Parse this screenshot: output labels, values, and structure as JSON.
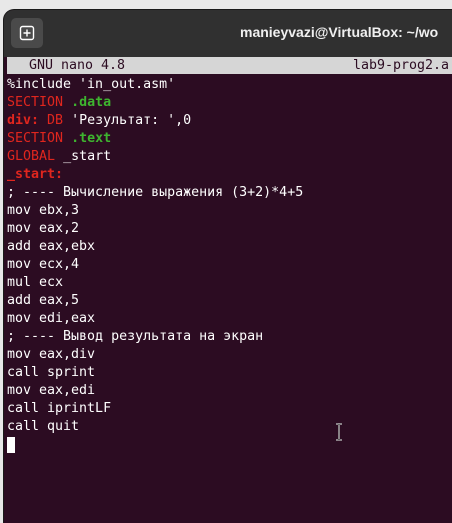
{
  "window": {
    "title": "manieyvazi@VirtualBox: ~/wo",
    "newtab_icon": "plus-in-square-icon"
  },
  "nano": {
    "version": "GNU nano 4.8",
    "filename": "lab9-prog2.a"
  },
  "lines": {
    "l1": "%include 'in_out.asm'",
    "l2a": "SECTION",
    "l2b": ".data",
    "l3a": "div:",
    "l3b": "DB",
    "l3c": "'Результат: ',0",
    "l4a": "SECTION",
    "l4b": ".text",
    "l5a": "GLOBAL",
    "l5b": "_start",
    "l6": "_start:",
    "l7": "; ---- Вычисление выражения (3+2)*4+5",
    "l8": "mov ebx,3",
    "l9": "mov eax,2",
    "l10": "add eax,ebx",
    "l11": "mov ecx,4",
    "l12": "mul ecx",
    "l13": "add eax,5",
    "l14": "mov edi,eax",
    "l15": "; ---- Вывод результата на экран",
    "l16": "mov eax,div",
    "l17": "call sprint",
    "l18": "mov eax,edi",
    "l19": "call iprintLF",
    "l20": "call quit"
  },
  "colors": {
    "terminal_bg": "#2c0c22",
    "keyword_red": "#e0261e",
    "keyword_green": "#3eb42f",
    "nano_bar_bg": "#d6d6d6"
  }
}
